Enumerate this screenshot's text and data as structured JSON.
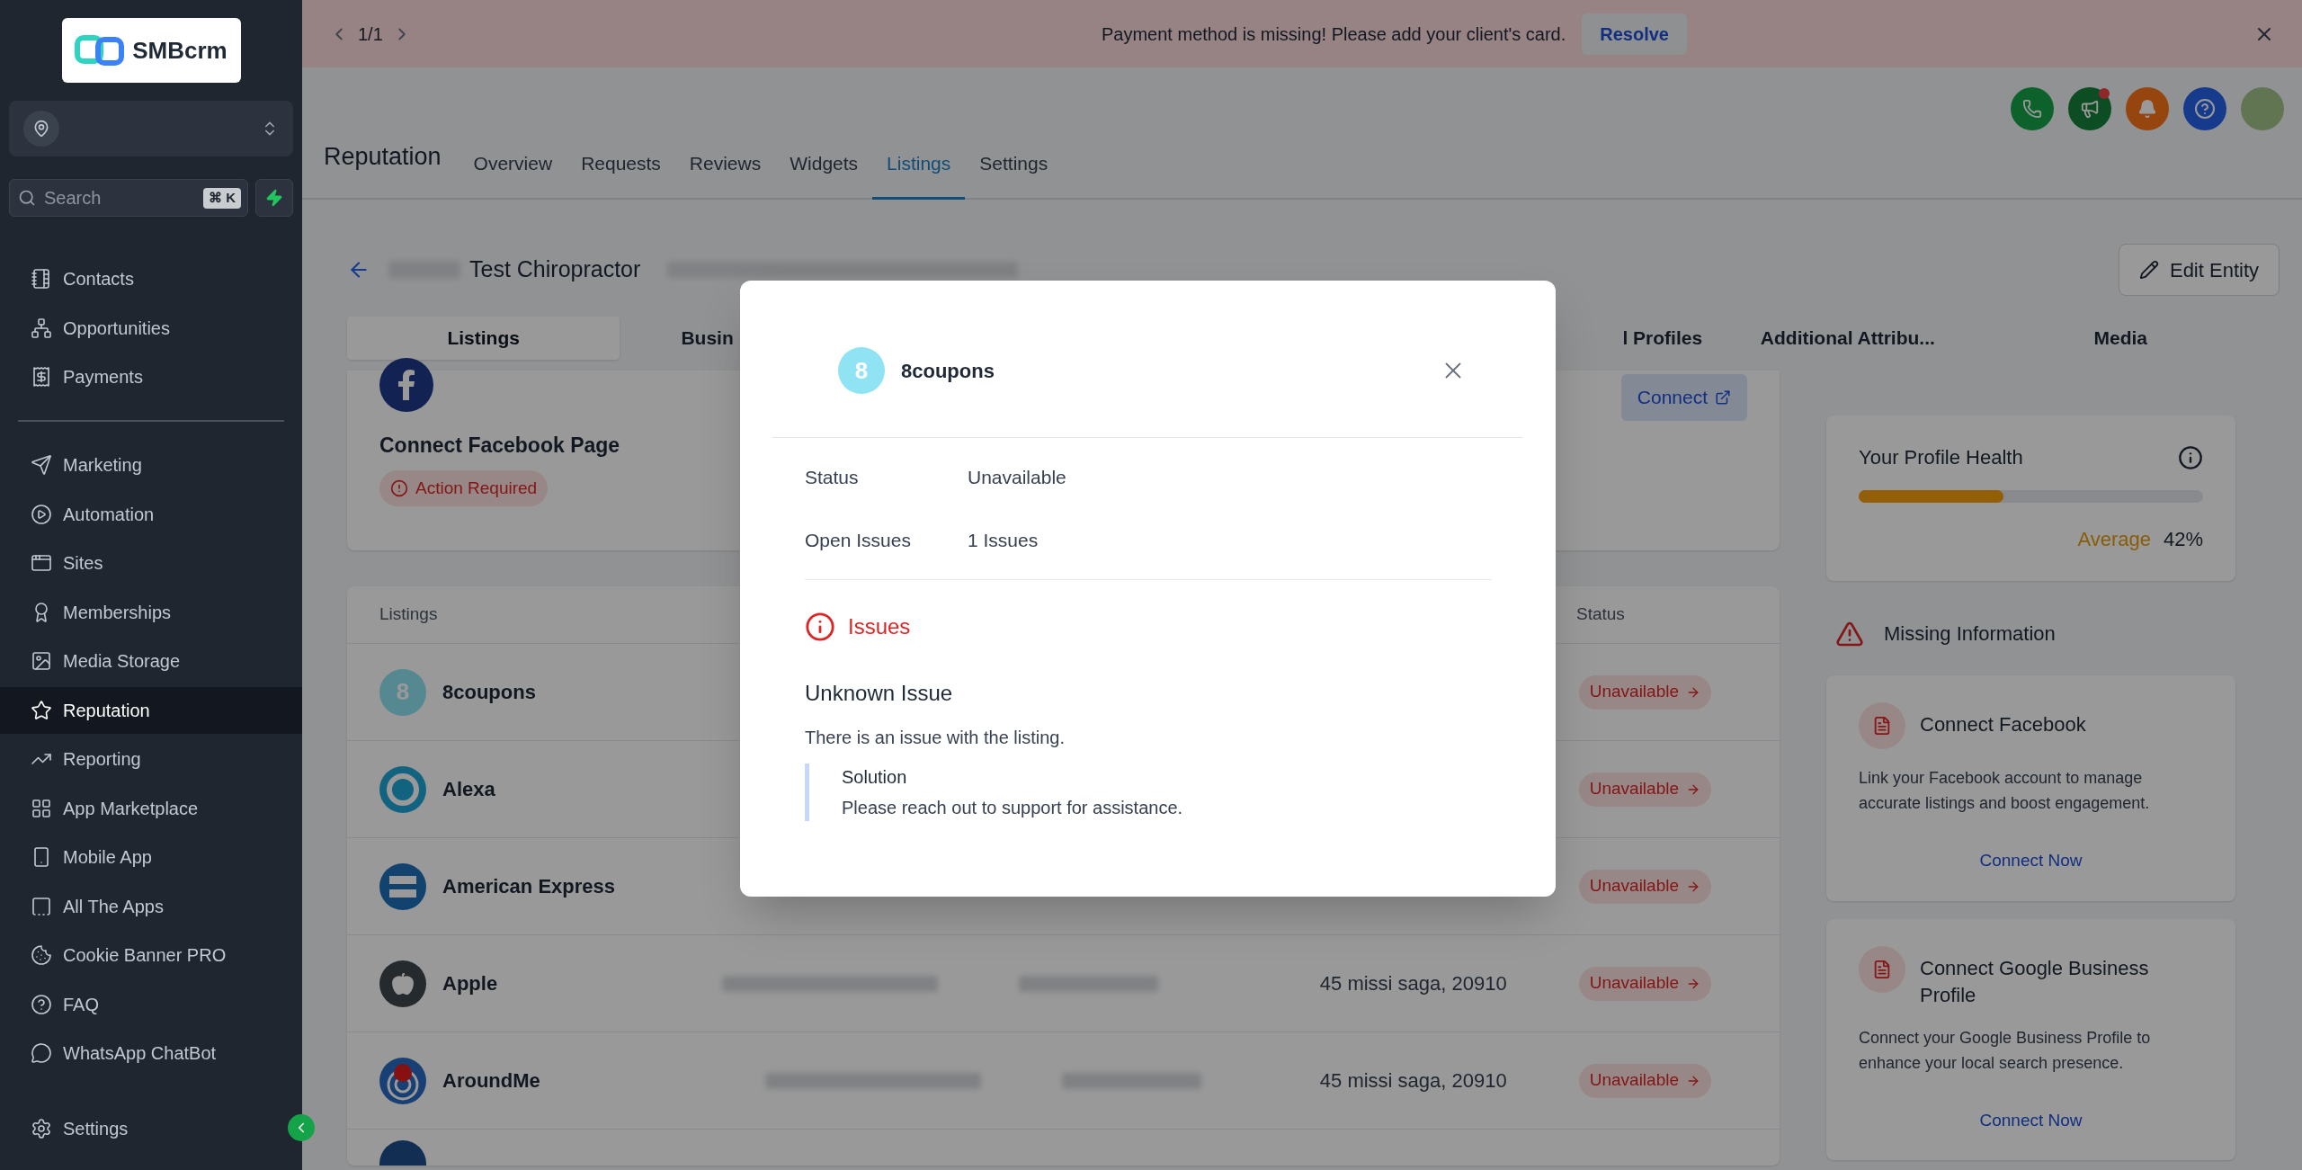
{
  "sidebar": {
    "logo": "SMBcrm",
    "search": {
      "placeholder": "Search",
      "shortcut": "⌘ K"
    },
    "groups": [
      [
        {
          "label": "Contacts",
          "selected": false
        },
        {
          "label": "Opportunities",
          "selected": false
        },
        {
          "label": "Payments",
          "selected": false
        }
      ],
      [
        {
          "label": "Marketing",
          "selected": false
        },
        {
          "label": "Automation",
          "selected": false
        },
        {
          "label": "Sites",
          "selected": false
        },
        {
          "label": "Memberships",
          "selected": false
        },
        {
          "label": "Media Storage",
          "selected": false
        },
        {
          "label": "Reputation",
          "selected": true
        },
        {
          "label": "Reporting",
          "selected": false
        },
        {
          "label": "App Marketplace",
          "selected": false
        },
        {
          "label": "Mobile App",
          "selected": false
        },
        {
          "label": "All The Apps",
          "selected": false
        },
        {
          "label": "Cookie Banner PRO",
          "selected": false
        },
        {
          "label": "FAQ",
          "selected": false
        },
        {
          "label": "WhatsApp ChatBot",
          "selected": false
        }
      ]
    ],
    "footer": {
      "label": "Settings",
      "selected": false
    }
  },
  "banner": {
    "pager": "1/1",
    "message": "Payment method is missing! Please add your client's card.",
    "action": "Resolve"
  },
  "header": {
    "title": "Reputation",
    "tabs": [
      {
        "label": "Overview",
        "selected": false
      },
      {
        "label": "Requests",
        "selected": false
      },
      {
        "label": "Reviews",
        "selected": false
      },
      {
        "label": "Widgets",
        "selected": false
      },
      {
        "label": "Listings",
        "selected": true
      },
      {
        "label": "Settings",
        "selected": false
      }
    ]
  },
  "entity": {
    "name": "Test Chiropractor",
    "action": "Edit Entity",
    "tabs": [
      {
        "label": "Listings",
        "selected": true
      },
      {
        "label": "Busin",
        "selected": false
      },
      {
        "label": "l Profiles",
        "selected": false
      },
      {
        "label": "Additional Attribu...",
        "selected": false
      },
      {
        "label": "Media",
        "selected": false
      }
    ]
  },
  "facebook_card": {
    "title": "Connect Facebook Page",
    "badge": "Action Required",
    "action": "Connect"
  },
  "table": {
    "columns": [
      "Listings",
      "Status"
    ],
    "rows": [
      {
        "name": "8coupons",
        "kind": "digit",
        "mark": "8",
        "status": "Unavailable"
      },
      {
        "name": "Alexa",
        "kind": "ring",
        "status": "Unavailable"
      },
      {
        "name": "American Express",
        "kind": "card",
        "status": "Unavailable"
      },
      {
        "name": "Apple",
        "kind": "fruit",
        "address": "45 missi saga, 20910",
        "status": "Unavailable"
      },
      {
        "name": "AroundMe",
        "kind": "target",
        "address": "45 missi saga, 20910",
        "status": "Unavailable"
      }
    ]
  },
  "health": {
    "title": "Your Profile Health",
    "level": 0.42,
    "rating": "Average",
    "percent": "42%"
  },
  "missing": {
    "title": "Missing Information",
    "items": [
      {
        "title": "Connect Facebook",
        "description": "Link your Facebook account to manage accurate listings and boost engagement.",
        "action": "Connect Now"
      },
      {
        "title": "Connect Google Business Profile",
        "description": "Connect your Google Business Profile to enhance your local search presence.",
        "action": "Connect Now"
      }
    ]
  },
  "modal": {
    "name": "8coupons",
    "mark": "8",
    "details": [
      {
        "label": "Status",
        "value": "Unavailable"
      },
      {
        "label": "Open Issues",
        "value": "1 Issues"
      }
    ],
    "issues_title": "Issues",
    "issue": {
      "title": "Unknown Issue",
      "description": "There is an issue with the listing.",
      "solution_title": "Solution",
      "solution": "Please reach out to support for assistance."
    }
  }
}
